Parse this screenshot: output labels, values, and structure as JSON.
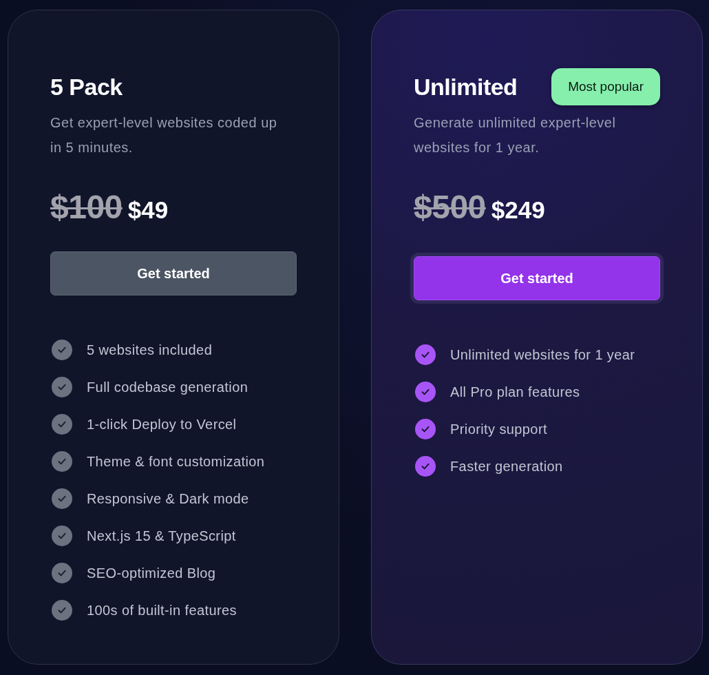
{
  "plans": [
    {
      "name": "5 Pack",
      "featured": false,
      "description": "Get expert-level websites coded up in 5 minutes.",
      "old_price": "$100",
      "price": "$49",
      "button": "Get started",
      "features": [
        "5 websites included",
        "Full codebase generation",
        "1-click Deploy to Vercel",
        "Theme & font customization",
        "Responsive & Dark mode",
        "Next.js 15 & TypeScript",
        "SEO-optimized Blog",
        "100s of built-in features"
      ]
    },
    {
      "name": "Unlimited",
      "badge": "Most popular",
      "featured": true,
      "description": "Generate unlimited expert-level websites for 1 year.",
      "old_price": "$500",
      "price": "$249",
      "button": "Get started",
      "features": [
        "Unlimited websites for 1 year",
        "All Pro plan features",
        "Priority support",
        "Faster generation"
      ]
    }
  ]
}
